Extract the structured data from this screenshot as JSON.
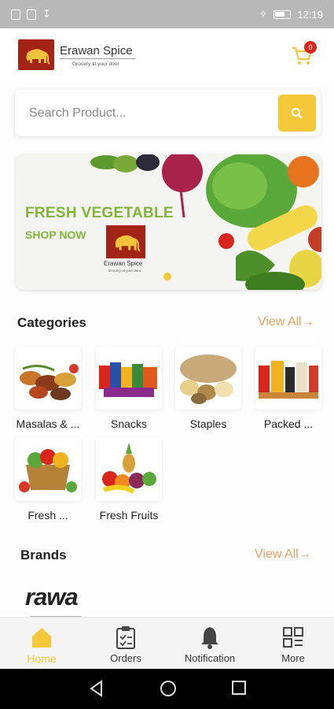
{
  "status_bar": {
    "time": "12:19"
  },
  "header": {
    "brand_name": "Erawan Spice",
    "brand_tagline": "Grocery at your door",
    "cart_count": "0"
  },
  "search": {
    "placeholder": "Search Product..."
  },
  "banner": {
    "title": "FRESH VEGETABLE",
    "subtitle": "SHOP NOW",
    "logo_name": "Erawan Spice",
    "logo_tagline": "Grocery at your door"
  },
  "categories": {
    "title": "Categories",
    "view_all": "View All→",
    "items": [
      {
        "label": "Masalas & ..."
      },
      {
        "label": "Snacks"
      },
      {
        "label": "Staples"
      },
      {
        "label": "Packed ..."
      },
      {
        "label": "Fresh ..."
      },
      {
        "label": "Fresh Fruits"
      }
    ]
  },
  "brands": {
    "title": "Brands",
    "view_all": "View All→",
    "items": [
      {
        "label": "rawa"
      }
    ]
  },
  "bottom_nav": {
    "items": [
      {
        "label": "Home",
        "icon": "home-icon"
      },
      {
        "label": "Orders",
        "icon": "clipboard-icon"
      },
      {
        "label": "Notification",
        "icon": "bell-icon"
      },
      {
        "label": "More",
        "icon": "grid-icon"
      }
    ]
  },
  "colors": {
    "accent": "#f5c83a",
    "link": "#e5a15f",
    "banner_green": "#82b53a",
    "logo_red": "#a32317"
  }
}
